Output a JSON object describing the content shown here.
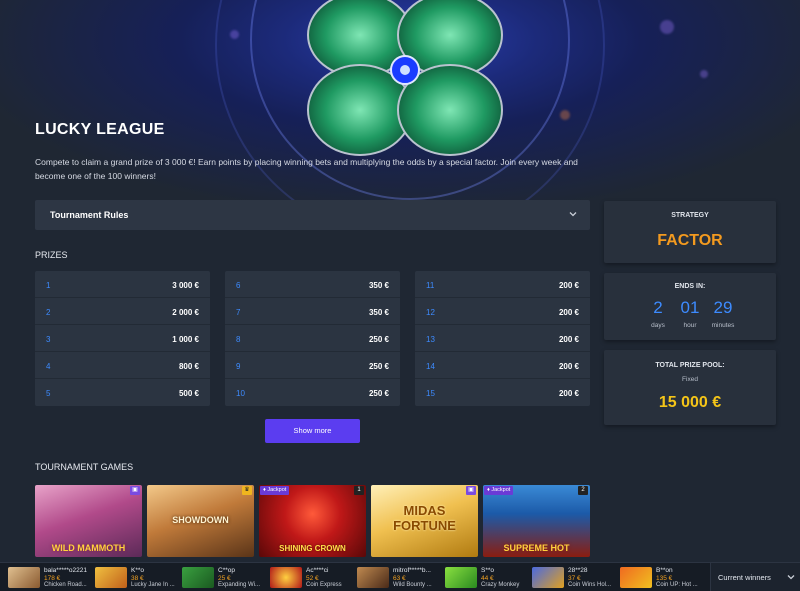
{
  "page": {
    "title": "LUCKY LEAGUE",
    "description": "Compete to claim a grand prize of 3 000 €! Earn points by placing winning bets and multiplying the odds by a special factor. Join every week and become one of the 100 winners!"
  },
  "rules": {
    "label": "Tournament Rules",
    "icon": "chevron-down-icon"
  },
  "prizes": {
    "heading": "PRIZES",
    "columns": [
      [
        {
          "rank": "1",
          "amount": "3 000 €"
        },
        {
          "rank": "2",
          "amount": "2 000 €"
        },
        {
          "rank": "3",
          "amount": "1 000 €"
        },
        {
          "rank": "4",
          "amount": "800 €"
        },
        {
          "rank": "5",
          "amount": "500 €"
        }
      ],
      [
        {
          "rank": "6",
          "amount": "350 €"
        },
        {
          "rank": "7",
          "amount": "350 €"
        },
        {
          "rank": "8",
          "amount": "250 €"
        },
        {
          "rank": "9",
          "amount": "250 €"
        },
        {
          "rank": "10",
          "amount": "250 €"
        }
      ],
      [
        {
          "rank": "11",
          "amount": "200 €"
        },
        {
          "rank": "12",
          "amount": "200 €"
        },
        {
          "rank": "13",
          "amount": "200 €"
        },
        {
          "rank": "14",
          "amount": "200 €"
        },
        {
          "rank": "15",
          "amount": "200 €"
        }
      ]
    ],
    "show_more": "Show more"
  },
  "strategy": {
    "caption": "STRATEGY",
    "value": "FACTOR"
  },
  "countdown": {
    "caption": "ENDS IN:",
    "units": [
      {
        "num": "2",
        "label": "days"
      },
      {
        "num": "01",
        "label": "hour"
      },
      {
        "num": "29",
        "label": "minutes"
      }
    ]
  },
  "pool": {
    "caption": "TOTAL PRIZE POOL:",
    "sub": "Fixed",
    "value": "15 000 €"
  },
  "games": {
    "heading": "TOURNAMENT GAMES",
    "items": [
      {
        "name": "WILD MAMMOTH",
        "tag": "",
        "badge": "gift-icon"
      },
      {
        "name": "SHOWDOWN",
        "tag": "",
        "badge": "crown-icon"
      },
      {
        "name": "SHINING CROWN",
        "tag": "Jackpot",
        "badge": "1"
      },
      {
        "name": "MIDAS FORTUNE",
        "tag": "",
        "badge": "gift-icon"
      },
      {
        "name": "SUPREME HOT",
        "tag": "Jackpot",
        "badge": "2"
      }
    ]
  },
  "ticker": {
    "entries": [
      {
        "user": "bala*****o2221",
        "amount": "178 €",
        "game": "Chicken Road..."
      },
      {
        "user": "K**o",
        "amount": "38 €",
        "game": "Lucky Jane In ..."
      },
      {
        "user": "C**op",
        "amount": "25 €",
        "game": "Expanding Wi..."
      },
      {
        "user": "Ac****ci",
        "amount": "52 €",
        "game": "Coin Express"
      },
      {
        "user": "mitrof*****b...",
        "amount": "63 €",
        "game": "Wild Bounty ..."
      },
      {
        "user": "S**o",
        "amount": "44 €",
        "game": "Crazy Monkey"
      },
      {
        "user": "28**28",
        "amount": "37 €",
        "game": "Coin Wins Hol..."
      },
      {
        "user": "B**on",
        "amount": "135 €",
        "game": "Coin UP: Hot ..."
      }
    ],
    "current_winners": "Current winners"
  },
  "colors": {
    "accent": "#3d8bff",
    "strategy": "#f39a1f",
    "pool": "#f5c518",
    "button": "#5b3df0"
  }
}
